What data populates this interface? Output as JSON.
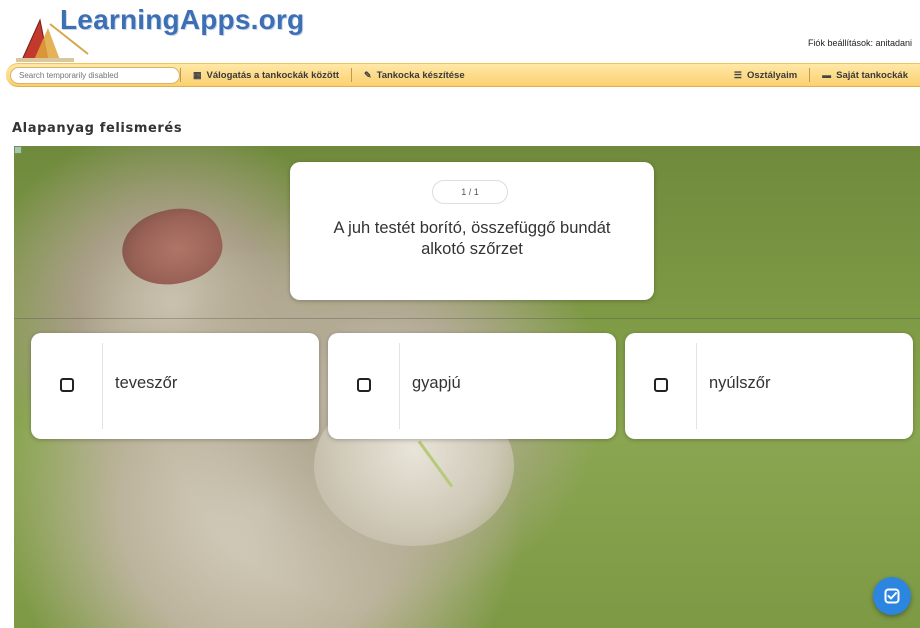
{
  "header": {
    "logo_text": "LearningApps.org",
    "account_link": "Fiók beállítások: anitadani"
  },
  "navbar": {
    "search_placeholder": "Search temporarily disabled",
    "items": [
      {
        "label": "Válogatás a tankockák között",
        "icon": "grid-icon"
      },
      {
        "label": "Tankocka készítése",
        "icon": "pencil-icon"
      },
      {
        "label": "Osztályaim",
        "icon": "list-icon"
      },
      {
        "label": "Saját tankockák",
        "icon": "folder-icon"
      }
    ]
  },
  "app": {
    "title": "Alapanyag felismerés",
    "counter": "1 / 1",
    "question": "A juh testét borító, összefüggő bundát alkotó szőrzet",
    "options": [
      {
        "label": "teveszőr"
      },
      {
        "label": "gyapjú"
      },
      {
        "label": "nyúlszőr"
      }
    ],
    "check_button_icon": "check-square-icon",
    "colors": {
      "navbar_bg": "#fbd071",
      "logo_blue": "#3d6fb5",
      "check_button": "#2c86e0",
      "card_bg": "#ffffff"
    }
  }
}
